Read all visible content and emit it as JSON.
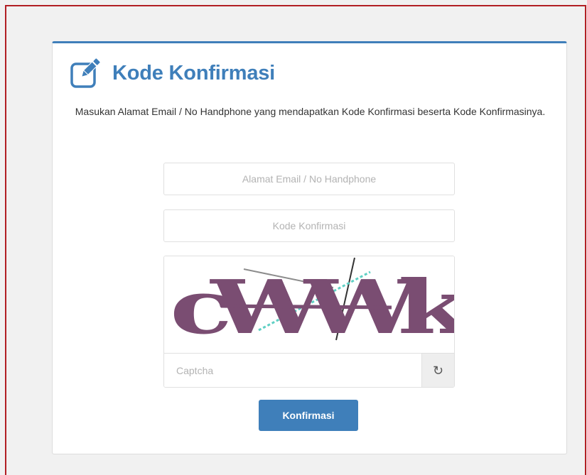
{
  "card": {
    "title": "Kode Konfirmasi",
    "title_icon": "edit-icon",
    "description": "Masukan Alamat Email / No Handphone yang mendapatkan Kode Konfirmasi beserta Kode Konfirmasinya."
  },
  "form": {
    "email": {
      "placeholder": "Alamat Email / No Handphone",
      "value": ""
    },
    "code": {
      "placeholder": "Kode Konfirmasi",
      "value": ""
    },
    "captcha": {
      "image_text": "cWWk",
      "placeholder": "Captcha",
      "value": "",
      "refresh_icon": "refresh-icon"
    },
    "submit_label": "Konfirmasi"
  },
  "colors": {
    "accent": "#3f7fba",
    "frame_border": "#b21f24",
    "captcha_text": "#7a4d72"
  }
}
